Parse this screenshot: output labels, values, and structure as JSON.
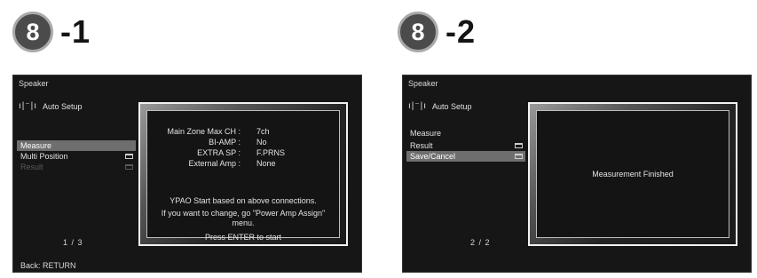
{
  "steps": [
    {
      "badge": "8",
      "label": "-1"
    },
    {
      "badge": "8",
      "label": "-2"
    }
  ],
  "screen1": {
    "header": "Speaker",
    "speaker_icon": "speaker-icon",
    "title": "Auto Setup",
    "menu": [
      {
        "label": "Measure",
        "state": "selected"
      },
      {
        "label": "Multi Position",
        "state": "normal",
        "folder": true
      },
      {
        "label": "Result",
        "state": "disabled",
        "folder": true
      }
    ],
    "page": "1 / 3",
    "footer": "Back: RETURN",
    "panel": {
      "rows": [
        {
          "label": "Main Zone Max CH :",
          "value": "7ch"
        },
        {
          "label": "BI-AMP :",
          "value": "No"
        },
        {
          "label": "EXTRA SP :",
          "value": "F.PRNS"
        },
        {
          "label": "External Amp :",
          "value": "None"
        }
      ],
      "message1": "YPAO Start based on above connections.",
      "message2": "If you want to change, go \"Power Amp Assign\"",
      "message3": "menu.",
      "message4": "Press ENTER to start"
    }
  },
  "screen2": {
    "header": "Speaker",
    "speaker_icon": "speaker-icon",
    "title": "Auto Setup",
    "menu": [
      {
        "label": "Measure",
        "state": "normal"
      },
      {
        "label": "Result",
        "state": "normal",
        "folder": true
      },
      {
        "label": "Save/Cancel",
        "state": "selected",
        "folder": true
      }
    ],
    "page": "2 / 2",
    "panel": {
      "message": "Measurement Finished"
    }
  }
}
